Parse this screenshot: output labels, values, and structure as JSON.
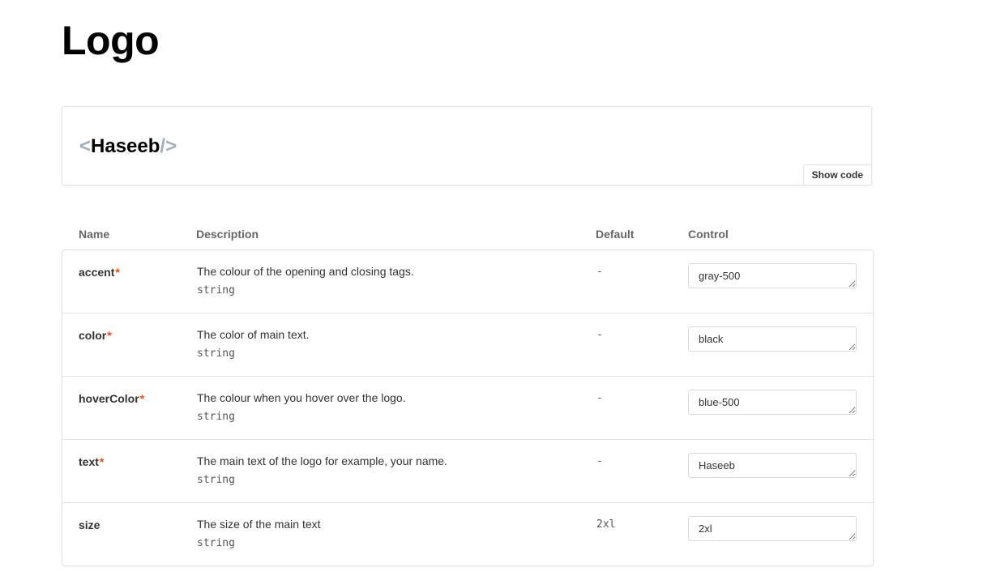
{
  "page": {
    "title": "Logo"
  },
  "preview": {
    "logo": {
      "open_tag": "<",
      "text": "Haseeb",
      "close_tag": "/>",
      "accent_color": "#a0aec0",
      "text_color": "#000000"
    },
    "show_code_label": "Show code"
  },
  "props_table": {
    "headers": {
      "name": "Name",
      "description": "Description",
      "default": "Default",
      "control": "Control"
    },
    "required_marker": "*",
    "required_color": "#ff4400",
    "rows": [
      {
        "name": "accent",
        "required": true,
        "description": "The colour of the opening and closing tags.",
        "type": "string",
        "default": "-",
        "control_value": "gray-500"
      },
      {
        "name": "color",
        "required": true,
        "description": "The color of main text.",
        "type": "string",
        "default": "-",
        "control_value": "black"
      },
      {
        "name": "hoverColor",
        "required": true,
        "description": "The colour when you hover over the logo.",
        "type": "string",
        "default": "-",
        "control_value": "blue-500"
      },
      {
        "name": "text",
        "required": true,
        "description": "The main text of the logo for example, your name.",
        "type": "string",
        "default": "-",
        "control_value": "Haseeb"
      },
      {
        "name": "size",
        "required": false,
        "description": "The size of the main text",
        "type": "string",
        "default": "2xl",
        "control_value": "2xl"
      }
    ]
  }
}
